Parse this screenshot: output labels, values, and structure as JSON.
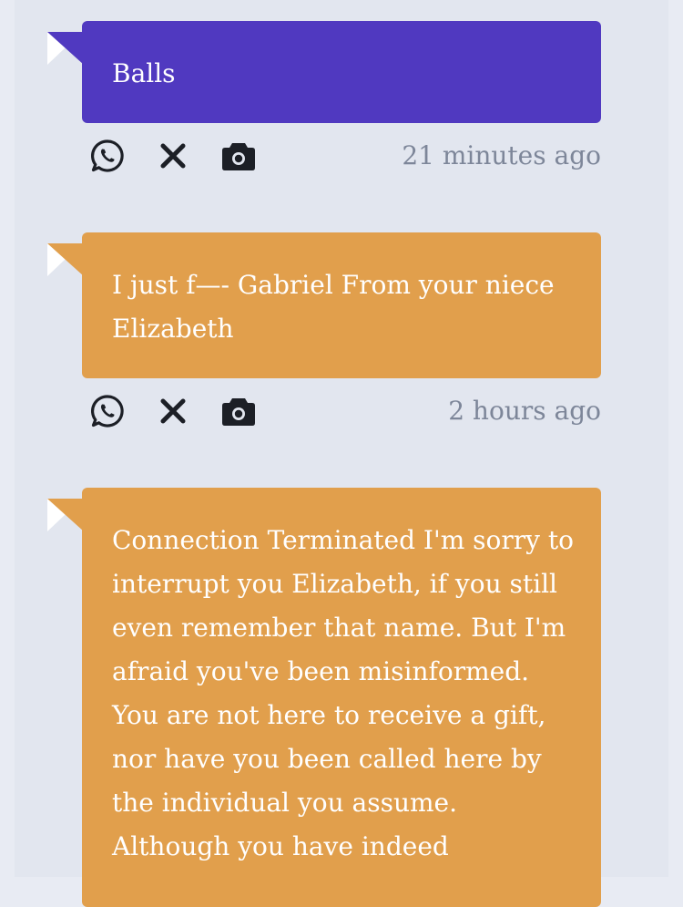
{
  "messages": [
    {
      "text": "Balls",
      "timestamp": "21 minutes ago",
      "color": "#5039c0"
    },
    {
      "text": "I just f—- Gabriel From your niece Elizabeth",
      "timestamp": "2 hours ago",
      "color": "#e19f4c"
    },
    {
      "text": "Connection Terminated I'm sorry to interrupt you Elizabeth, if you still even remember that name. But I'm afraid you've been misinformed. You are not here to receive a gift, nor have you been called here by the individual you assume. Although you have indeed",
      "color": "#e19f4c"
    }
  ],
  "action_icons": [
    "whatsapp-icon",
    "close-icon",
    "camera-icon"
  ],
  "colors": {
    "page_bg": "#e8ebf3",
    "column_bg": "#e2e6ef",
    "timestamp_text": "#7d8699",
    "icon": "#1c1f26"
  }
}
